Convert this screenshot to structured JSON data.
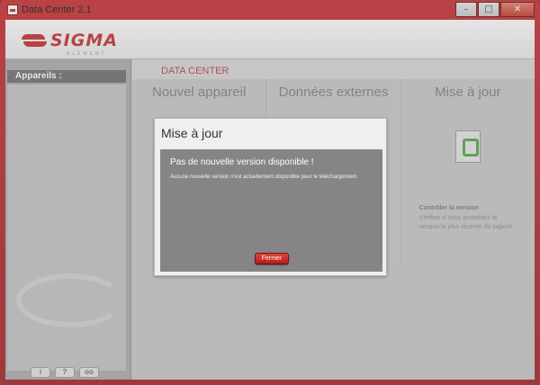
{
  "window": {
    "title": "Data Center 2.1",
    "buttons": {
      "minimize": "–",
      "maximize": "□",
      "close": "✕"
    }
  },
  "header": {
    "logo_text": "SIGMA",
    "logo_sub": "ELEMENT"
  },
  "sidebar": {
    "heading": "Appareils :",
    "footer_buttons": [
      "i",
      "?",
      "oo"
    ]
  },
  "main": {
    "section_label": "DATA CENTER",
    "columns": [
      {
        "title": "Nouvel appareil"
      },
      {
        "title": "Données externes"
      },
      {
        "title": "Mise à jour",
        "desc_head": "Contrôler la version",
        "desc": "Vérifiez si vous possédez la version la plus récente du logiciel."
      }
    ]
  },
  "dialog": {
    "title": "Mise à jour",
    "headline": "Pas de nouvelle version disponible !",
    "message": "Aucune nouvelle version n'est actuellement disponible pour le téléchargement.",
    "button": "Fermer"
  },
  "colors": {
    "accent": "#c3262b",
    "frame": "#a31b1b",
    "dialog_body": "#858585"
  }
}
